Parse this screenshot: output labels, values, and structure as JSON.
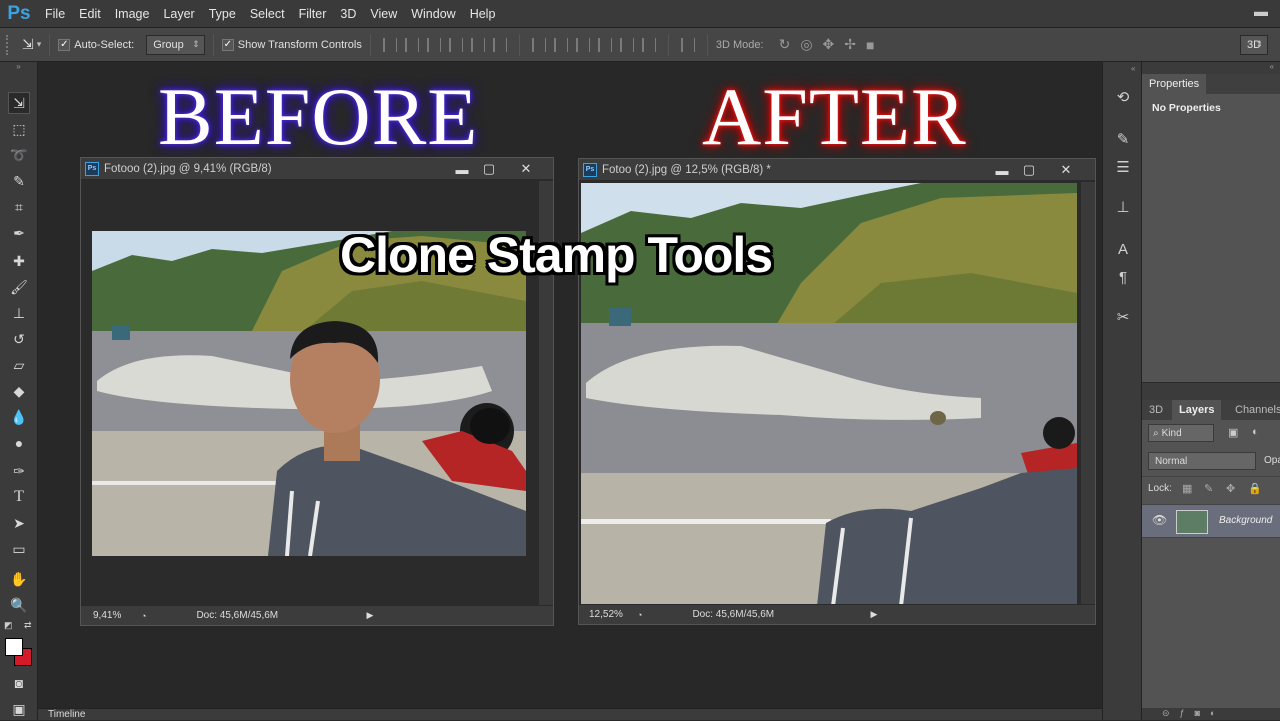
{
  "app": {
    "logo": "Ps"
  },
  "menu": [
    "File",
    "Edit",
    "Image",
    "Layer",
    "Type",
    "Select",
    "Filter",
    "3D",
    "View",
    "Window",
    "Help"
  ],
  "options": {
    "auto_select_label": "Auto-Select:",
    "auto_select_value": "Group",
    "show_transform_label": "Show Transform Controls",
    "mode_3d_label": "3D Mode:",
    "workspace": "3D"
  },
  "overlay": {
    "before": "BEFORE",
    "after": "AFTER",
    "caption": "Clone Stamp Tools"
  },
  "doc_left": {
    "title": "Fotooo (2).jpg @ 9,41% (RGB/8)",
    "zoom": "9,41%",
    "doc_size": "Doc: 45,6M/45,6M"
  },
  "doc_right": {
    "title": "Fotoo (2).jpg @ 12,5% (RGB/8) *",
    "zoom": "12,52%",
    "doc_size": "Doc: 45,6M/45,6M"
  },
  "properties": {
    "tab": "Properties",
    "content": "No Properties"
  },
  "layers_panel": {
    "tabs": [
      "3D",
      "Layers",
      "Channels"
    ],
    "kind_label": "Kind",
    "blend_mode": "Normal",
    "opacity_label": "Opa",
    "lock_label": "Lock:",
    "layer_name": "Background"
  },
  "timeline": {
    "label": "Timeline"
  },
  "colors": {
    "accent": "#3aa3e3",
    "foreground": "#ffffff",
    "background": "#d21a2a"
  }
}
